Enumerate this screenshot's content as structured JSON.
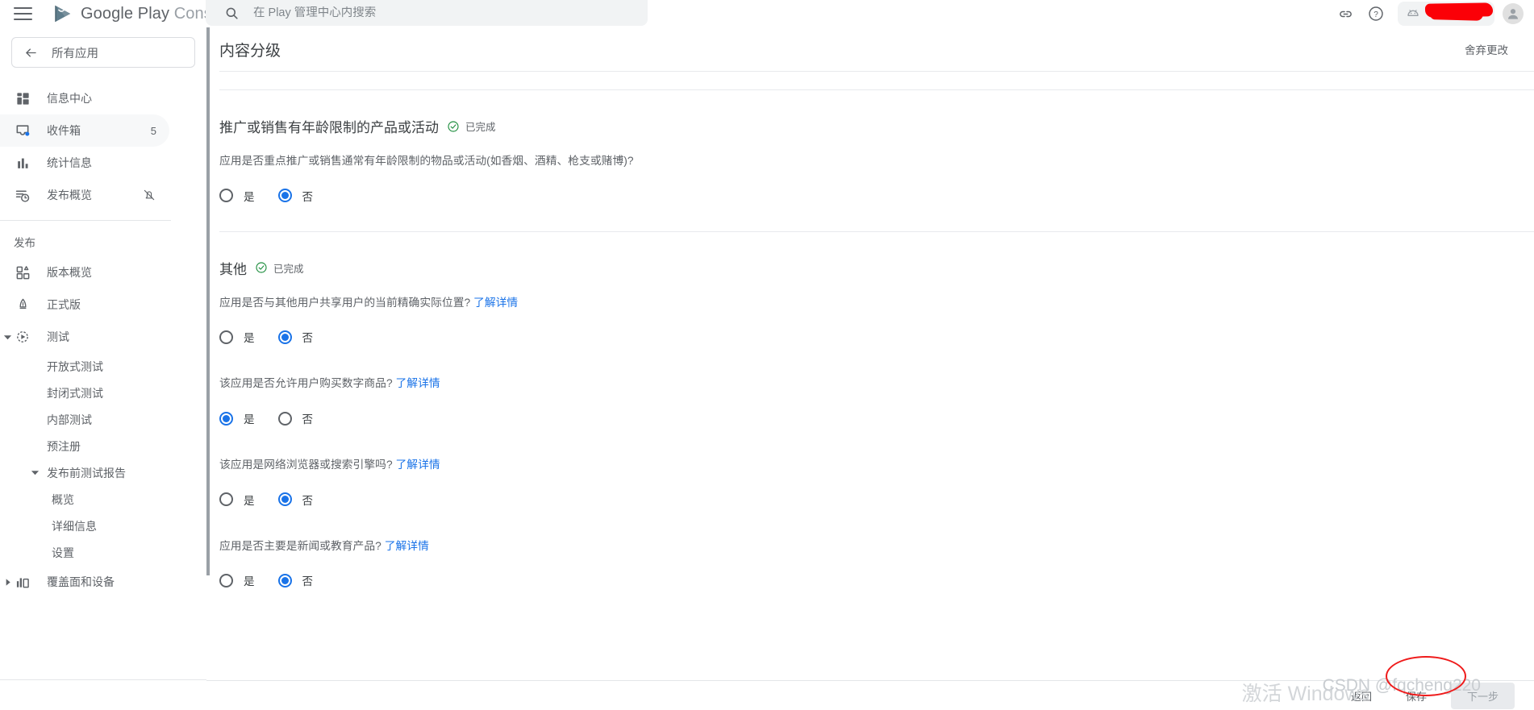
{
  "topbar": {
    "menu_icon": "hamburger-menu-icon",
    "brand_primary": "Google Play",
    "brand_secondary": "Console",
    "logo_icon": "google-play-logo-icon",
    "search": {
      "icon": "search-icon",
      "placeholder": "在 Play 管理中心内搜索",
      "value": ""
    },
    "actions": {
      "link_icon": "link-icon",
      "help_icon": "help-circle-icon",
      "app_chip_icon": "android-head-icon",
      "app_chip_label": "",
      "avatar_icon": "account-avatar-icon"
    }
  },
  "sidebar": {
    "back_icon": "arrow-left-icon",
    "all_apps_label": "所有应用",
    "primary_items": [
      {
        "label": "信息中心",
        "icon": "dashboard-icon",
        "badge": "",
        "trailing_icon": "",
        "active": false
      },
      {
        "label": "收件箱",
        "icon": "inbox-icon",
        "badge": "5",
        "trailing_icon": "",
        "active": true
      },
      {
        "label": "统计信息",
        "icon": "bar-chart-icon",
        "badge": "",
        "trailing_icon": "",
        "active": false
      },
      {
        "label": "发布概览",
        "icon": "release-timeline-icon",
        "badge": "",
        "trailing_icon": "bell-off-icon",
        "active": false
      }
    ],
    "section_label": "发布",
    "publish_items": [
      {
        "label": "版本概览",
        "icon": "release-overview-icon",
        "caret": "",
        "indent": 0
      },
      {
        "label": "正式版",
        "icon": "production-rocket-icon",
        "caret": "",
        "indent": 0
      },
      {
        "label": "测试",
        "icon": "testing-play-icon",
        "caret": "caret-down-icon",
        "indent": 0
      },
      {
        "label": "开放式测试",
        "icon": "",
        "caret": "",
        "indent": 1
      },
      {
        "label": "封闭式测试",
        "icon": "",
        "caret": "",
        "indent": 1
      },
      {
        "label": "内部测试",
        "icon": "",
        "caret": "",
        "indent": 1
      },
      {
        "label": "预注册",
        "icon": "",
        "caret": "",
        "indent": 1
      },
      {
        "label": "发布前测试报告",
        "icon": "",
        "caret": "caret-down-icon",
        "indent": 1
      },
      {
        "label": "概览",
        "icon": "",
        "caret": "",
        "indent": 2
      },
      {
        "label": "详细信息",
        "icon": "",
        "caret": "",
        "indent": 2
      },
      {
        "label": "设置",
        "icon": "",
        "caret": "",
        "indent": 2
      },
      {
        "label": "覆盖面和设备",
        "icon": "reach-devices-icon",
        "caret": "caret-right-icon",
        "indent": 0
      }
    ]
  },
  "main": {
    "page_title": "内容分级",
    "discard_label": "舍弃更改",
    "done_label": "已完成",
    "done_icon": "check-circle-icon",
    "yes_label": "是",
    "no_label": "否",
    "learn_more_label": "了解详情",
    "accent_color": "#9aa0a6",
    "selected_color": "#1a73e8",
    "link_color": "#1a73e8",
    "done_color": "#1e8e3e",
    "sections": [
      {
        "title": "推广或销售有年龄限制的产品或活动",
        "status": "已完成",
        "questions": [
          {
            "text": "应用是否重点推广或销售通常有年龄限制的物品或活动(如香烟、酒精、枪支或赌博)?",
            "learn_more": false,
            "selected": "no"
          }
        ]
      },
      {
        "title": "其他",
        "status": "已完成",
        "questions": [
          {
            "text": "应用是否与其他用户共享用户的当前精确实际位置?",
            "learn_more": true,
            "selected": "no"
          },
          {
            "text": "该应用是否允许用户购买数字商品?",
            "learn_more": true,
            "selected": "yes"
          },
          {
            "text": "该应用是网络浏览器或搜索引擎吗?",
            "learn_more": true,
            "selected": "no"
          },
          {
            "text": "应用是否主要是新闻或教育产品?",
            "learn_more": true,
            "selected": "no"
          }
        ]
      }
    ]
  },
  "bottombar": {
    "back_label": "返回",
    "save_label": "保存",
    "next_label": "下一步"
  },
  "overlays": {
    "windows_watermark": "激活 Windows",
    "csdn_watermark": "CSDN @fqcheng220",
    "annotation_shape": "red-ellipse-annotation"
  }
}
